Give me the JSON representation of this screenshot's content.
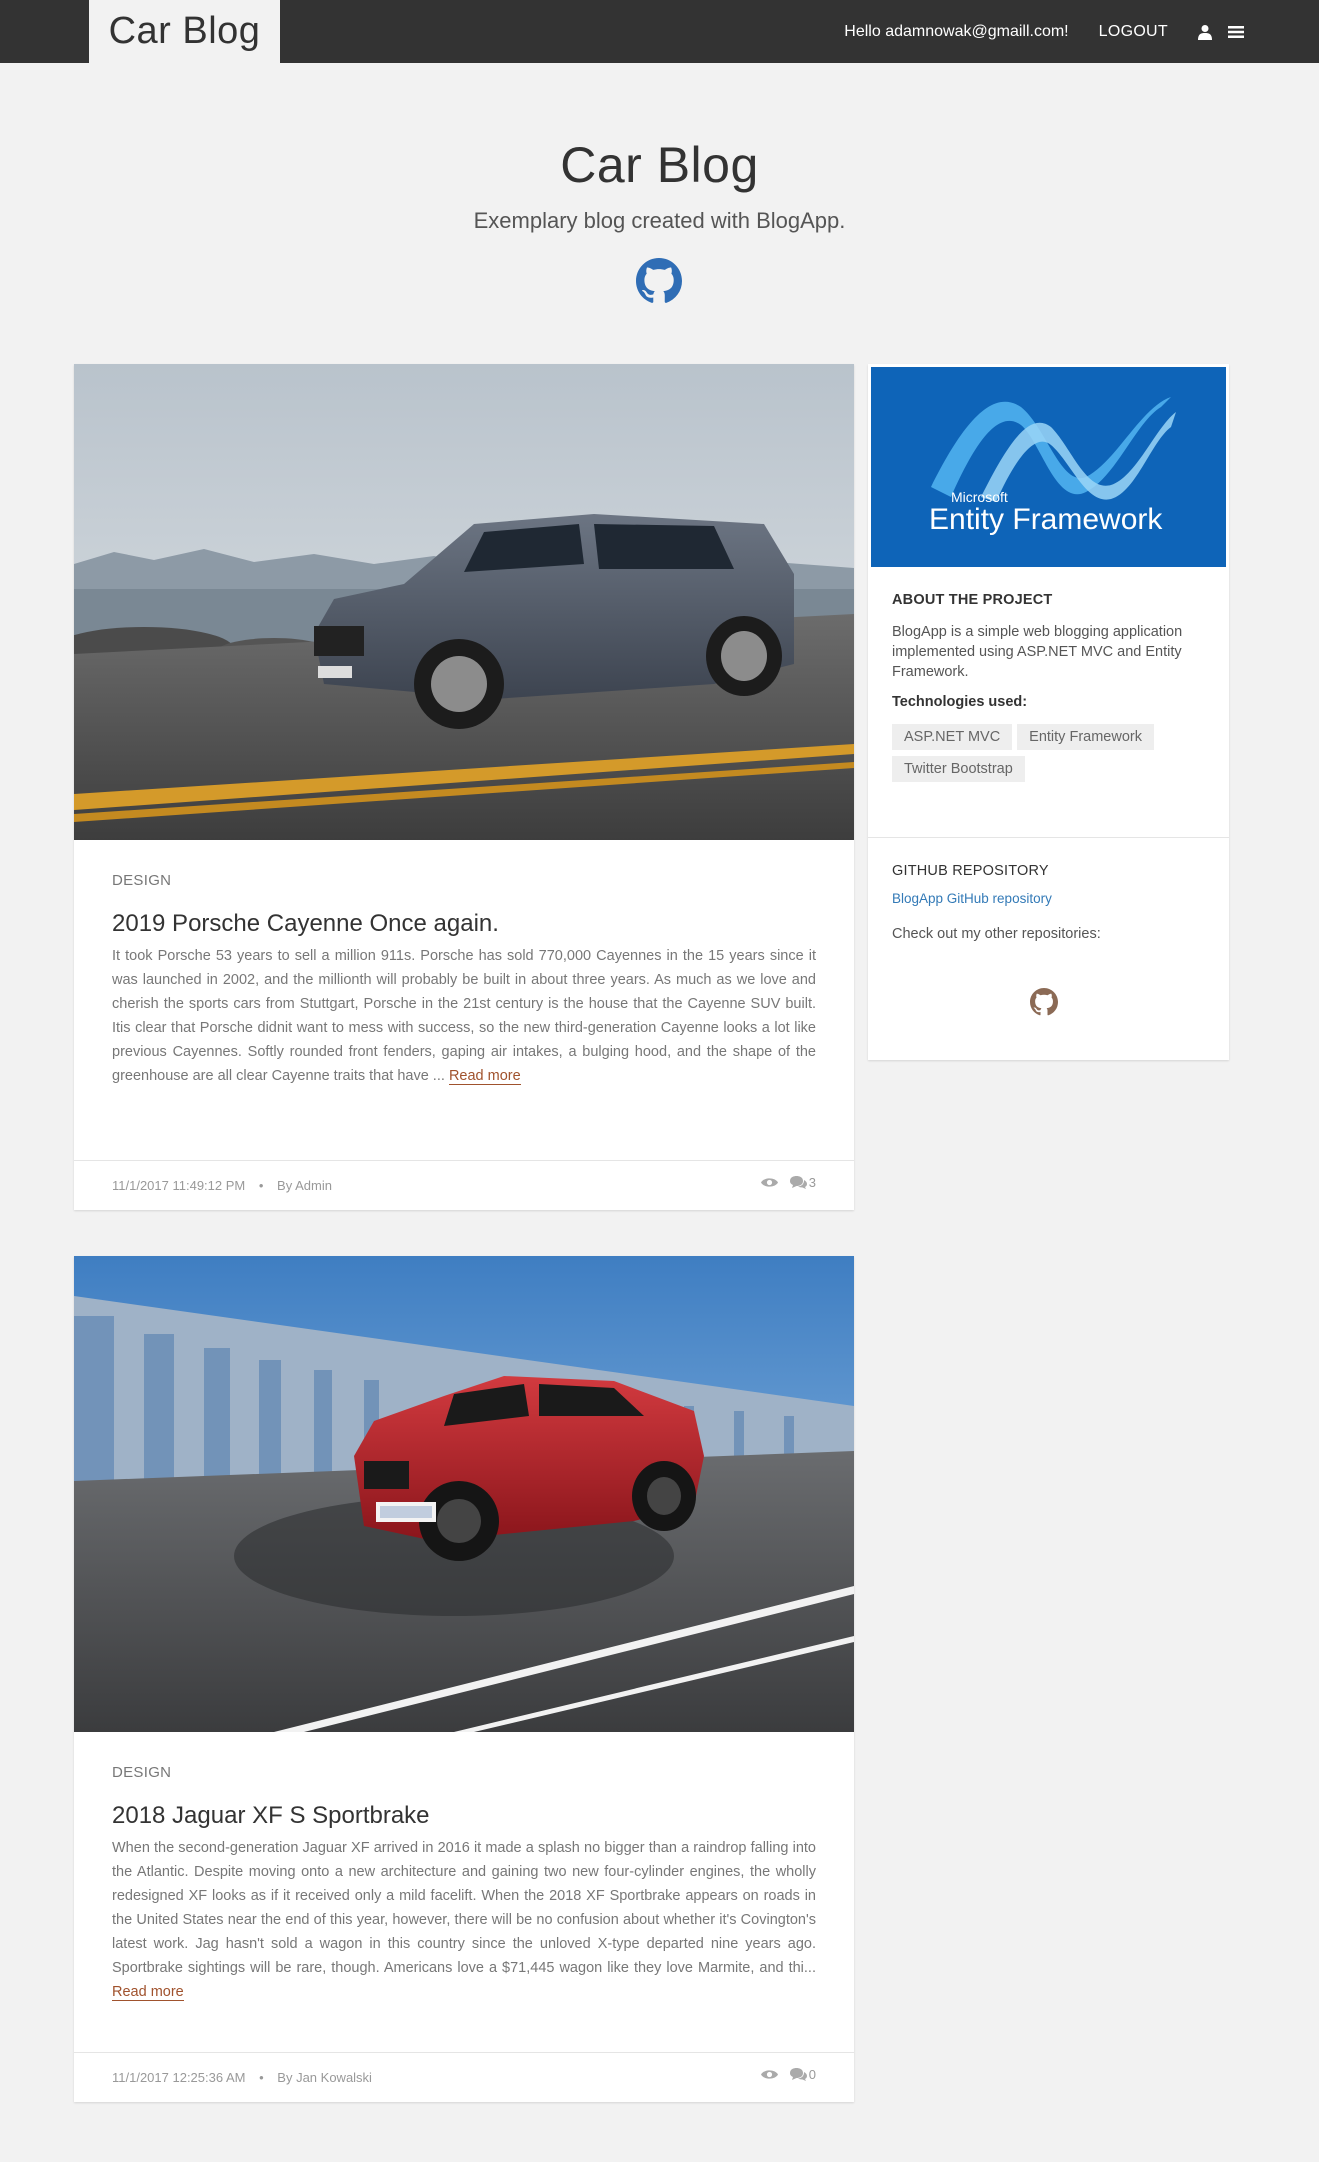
{
  "navbar": {
    "brand": "Car Blog",
    "hello": "Hello adamnowak@gmaill.com!",
    "logout": "LOGOUT",
    "icons": [
      "user-icon",
      "menu-icon"
    ]
  },
  "header": {
    "title": "Car Blog",
    "subtitle": "Exemplary blog created with BlogApp.",
    "icon": "github-icon"
  },
  "posts": [
    {
      "category": "DESIGN",
      "title": "2019 Porsche Cayenne Once again.",
      "excerpt": "It took Porsche 53 years to sell a million 911s. Porsche has sold 770,000 Cayennes in the 15 years since it was launched in 2002, and the millionth will probably be built in about three years. As much as we love and cherish the sports cars from Stuttgart, Porsche in the 21st century is the house that the Cayenne SUV built. Itis clear that Porsche didnit want to mess with success, so the new third-generation Cayenne looks a lot like previous Cayennes. Softly rounded front fenders, gaping air intakes, a bulging hood, and the shape of the greenhouse are all clear Cayenne traits that have ...",
      "read_more": "Read more",
      "date": "11/1/2017 11:49:12 PM",
      "author": "By Admin",
      "comments": "3",
      "image": "grey-porsche-cayenne-on-coastal-road"
    },
    {
      "category": "DESIGN",
      "title": "2018 Jaguar XF S Sportbrake",
      "excerpt": "When the second-generation Jaguar XF arrived in 2016 it made a splash no bigger than a raindrop falling into the Atlantic. Despite moving onto a new architecture and gaining two new four-cylinder engines, the wholly redesigned XF looks as if it received only a mild facelift. When the 2018 XF Sportbrake appears on roads in the United States near the end of this year, however, there will be no confusion about whether it's Covington's latest work. Jag hasn't sold a wagon in this country since the unloved X-type departed nine years ago. Sportbrake sightings will be rare, though. Americans love a $71,445 wagon like they love Marmite, and thi...",
      "read_more": "Read more",
      "date": "11/1/2017 12:25:36 AM",
      "author": "By Jan Kowalski",
      "comments": "0",
      "image": "red-jaguar-xf-sportbrake-on-bridge"
    }
  ],
  "sidebar": {
    "banner": {
      "microsoft": "Microsoft",
      "product": "Entity Framework"
    },
    "about": {
      "heading": "ABOUT THE PROJECT",
      "text": "BlogApp is a simple web blogging application implemented using ASP.NET MVC and Entity Framework.",
      "tech_label": "Technologies used:",
      "tags": [
        "ASP.NET MVC",
        "Entity Framework",
        "Twitter Bootstrap"
      ]
    },
    "github": {
      "heading": "GITHUB REPOSITORY",
      "link": "BlogApp GitHub repository",
      "text": "Check out my other repositories:",
      "icon": "github-icon"
    }
  },
  "colors": {
    "navbar": "#333333",
    "background": "#f2f2f2",
    "link": "#337ab7",
    "read_more": "#a0522d",
    "github_blue": "#2f6db5",
    "github_brown": "#8b6a55"
  }
}
